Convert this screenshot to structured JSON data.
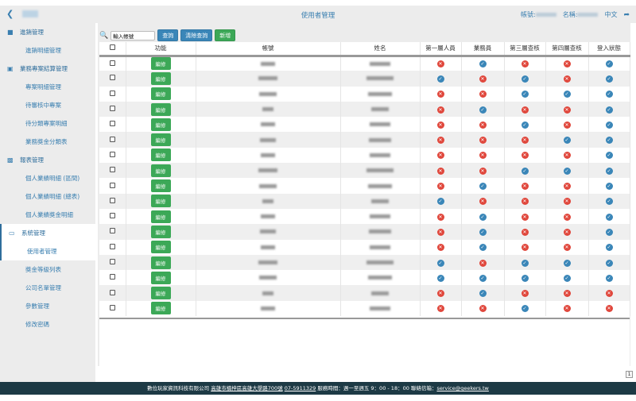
{
  "header": {
    "back_icon": "chevron-left-icon",
    "title": "使用者管理",
    "account_label": "帳號:",
    "name_label": "名稱:",
    "language": "中文",
    "logout_icon": "share-arrow-icon"
  },
  "sidebar": [
    {
      "label": "進銷管理",
      "icon": "book-icon",
      "items": [
        "進銷明細管理"
      ]
    },
    {
      "label": "業務專案結算管理",
      "icon": "tablet-icon",
      "items": [
        "專案明細管理",
        "待審核中專案",
        "待分類專案明細",
        "業務獎金分類表"
      ]
    },
    {
      "label": "報表管理",
      "icon": "bar-chart-icon",
      "items": [
        "個人業績明細 (區間)",
        "個人業績明細 (總表)",
        "個人業績獎金明細"
      ]
    },
    {
      "label": "系統管理",
      "icon": "terminal-icon",
      "items": [
        "使用者管理",
        "獎金等級列表",
        "公司名單管理",
        "參數管理",
        "修改密碼"
      ],
      "active_item": "使用者管理"
    }
  ],
  "toolbar": {
    "search_placeholder": "輸入帳號",
    "query": "查詢",
    "clear": "清除查詢",
    "add": "新增"
  },
  "table": {
    "columns": [
      "",
      "功能",
      "帳號",
      "姓名",
      "第一層人員",
      "業務員",
      "第三層查核",
      "第四層查核",
      "登入狀態"
    ],
    "edit_label": "編修",
    "rows": [
      [
        0,
        1,
        0,
        0,
        1
      ],
      [
        1,
        0,
        1,
        0,
        1
      ],
      [
        0,
        0,
        1,
        1,
        1
      ],
      [
        0,
        1,
        0,
        0,
        1
      ],
      [
        0,
        0,
        1,
        0,
        1
      ],
      [
        0,
        0,
        0,
        1,
        1
      ],
      [
        0,
        0,
        0,
        0,
        1
      ],
      [
        0,
        0,
        1,
        1,
        1
      ],
      [
        0,
        1,
        0,
        0,
        1
      ],
      [
        1,
        0,
        0,
        0,
        1
      ],
      [
        0,
        1,
        0,
        0,
        1
      ],
      [
        0,
        1,
        0,
        0,
        1
      ],
      [
        0,
        1,
        0,
        0,
        1
      ],
      [
        1,
        0,
        1,
        1,
        1
      ],
      [
        1,
        1,
        1,
        1,
        1
      ],
      [
        0,
        1,
        0,
        0,
        0
      ],
      [
        0,
        0,
        1,
        0,
        0
      ]
    ]
  },
  "pagination": {
    "page": "1"
  },
  "footer": {
    "company": "數位玩家資訊科技有限公司",
    "address": "高雄市楠梓區高雄大學路700號",
    "phone": "07-5911329",
    "hours": "服務時間：週一至週五 9：00 - 18：00",
    "email_label": "聯絡信箱：",
    "email": "service@geekers.tw"
  },
  "colors": {
    "check": "#3a86b8",
    "cross": "#e0473c",
    "button_green": "#3ca857",
    "button_blue": "#3a86b8",
    "footer": "#1d3a45"
  }
}
